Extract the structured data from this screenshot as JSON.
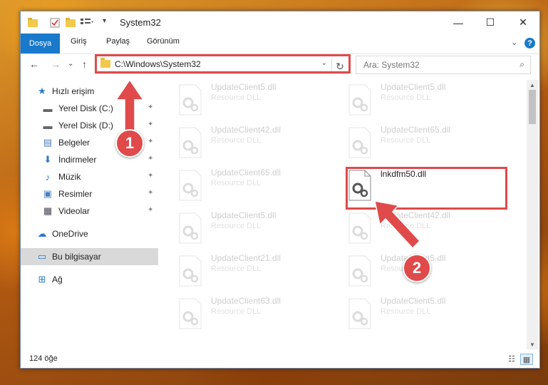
{
  "window": {
    "title": "System32",
    "controls": {
      "minimize": "—",
      "maximize": "☐",
      "close": "✕"
    }
  },
  "ribbon": {
    "tabs": [
      "Dosya",
      "Giriş",
      "Paylaş",
      "Görünüm"
    ],
    "collapse": "⌄",
    "help": "?"
  },
  "address": {
    "path": "C:\\Windows\\System32",
    "dropdown": "⌄",
    "refresh": "↻"
  },
  "search": {
    "placeholder": "Ara: System32",
    "icon": "⌕"
  },
  "nav": {
    "back": "←",
    "forward": "→",
    "recent": "⌄",
    "up": "↑"
  },
  "sidebar": {
    "items": [
      {
        "label": "Hızlı erişim",
        "icon": "star-icon",
        "glyph": "★"
      },
      {
        "label": "Yerel Disk (C:)",
        "icon": "drive-icon",
        "glyph": "▬",
        "pinned": "✦"
      },
      {
        "label": "Yerel Disk (D:)",
        "icon": "drive-icon",
        "glyph": "▬",
        "pinned": "✦"
      },
      {
        "label": "Belgeler",
        "icon": "documents-icon",
        "glyph": "▤",
        "pinned": "✦"
      },
      {
        "label": "İndirmeler",
        "icon": "download-icon",
        "glyph": "⬇",
        "pinned": "✦"
      },
      {
        "label": "Müzik",
        "icon": "music-icon",
        "glyph": "♪",
        "pinned": "✦"
      },
      {
        "label": "Resimler",
        "icon": "pictures-icon",
        "glyph": "▣",
        "pinned": "✦"
      },
      {
        "label": "Videolar",
        "icon": "videos-icon",
        "glyph": "▦",
        "pinned": "✦"
      },
      {
        "label": "OneDrive",
        "icon": "cloud-icon",
        "glyph": "☁"
      },
      {
        "label": "Bu bilgisayar",
        "icon": "computer-icon",
        "glyph": "▭"
      },
      {
        "label": "Ağ",
        "icon": "network-icon",
        "glyph": "⊞"
      }
    ]
  },
  "files": {
    "left": [
      {
        "name": "UpdateClient5.dll",
        "type": "Resource DLL"
      },
      {
        "name": "UpdateClient42.dll",
        "type": "Resource DLL"
      },
      {
        "name": "UpdateClient65.dll",
        "type": "Resource DLL"
      },
      {
        "name": "UpdateClient5.dll",
        "type": "Resource DLL"
      },
      {
        "name": "UpdateClient21.dll",
        "type": "Resource DLL"
      },
      {
        "name": "UpdateClient63.dll",
        "type": "Resource DLL"
      }
    ],
    "right": [
      {
        "name": "UpdateClient5.dll",
        "type": "Resource DLL"
      },
      {
        "name": "UpdateClient65.dll",
        "type": "Resource DLL"
      },
      {
        "name": "lnkdfm50.dll",
        "type": ""
      },
      {
        "name": "UpdateClient42.dll",
        "type": "Resource DLL"
      },
      {
        "name": "UpdateClient5.dll",
        "type": "Resource DLL"
      },
      {
        "name": "UpdateClient5.dll",
        "type": "Resource DLL"
      }
    ]
  },
  "status": {
    "count": "124 öğe"
  },
  "annotations": {
    "badge1": "1",
    "badge2": "2"
  },
  "colors": {
    "accent": "#1979ca",
    "annotation": "#e04a4a"
  }
}
